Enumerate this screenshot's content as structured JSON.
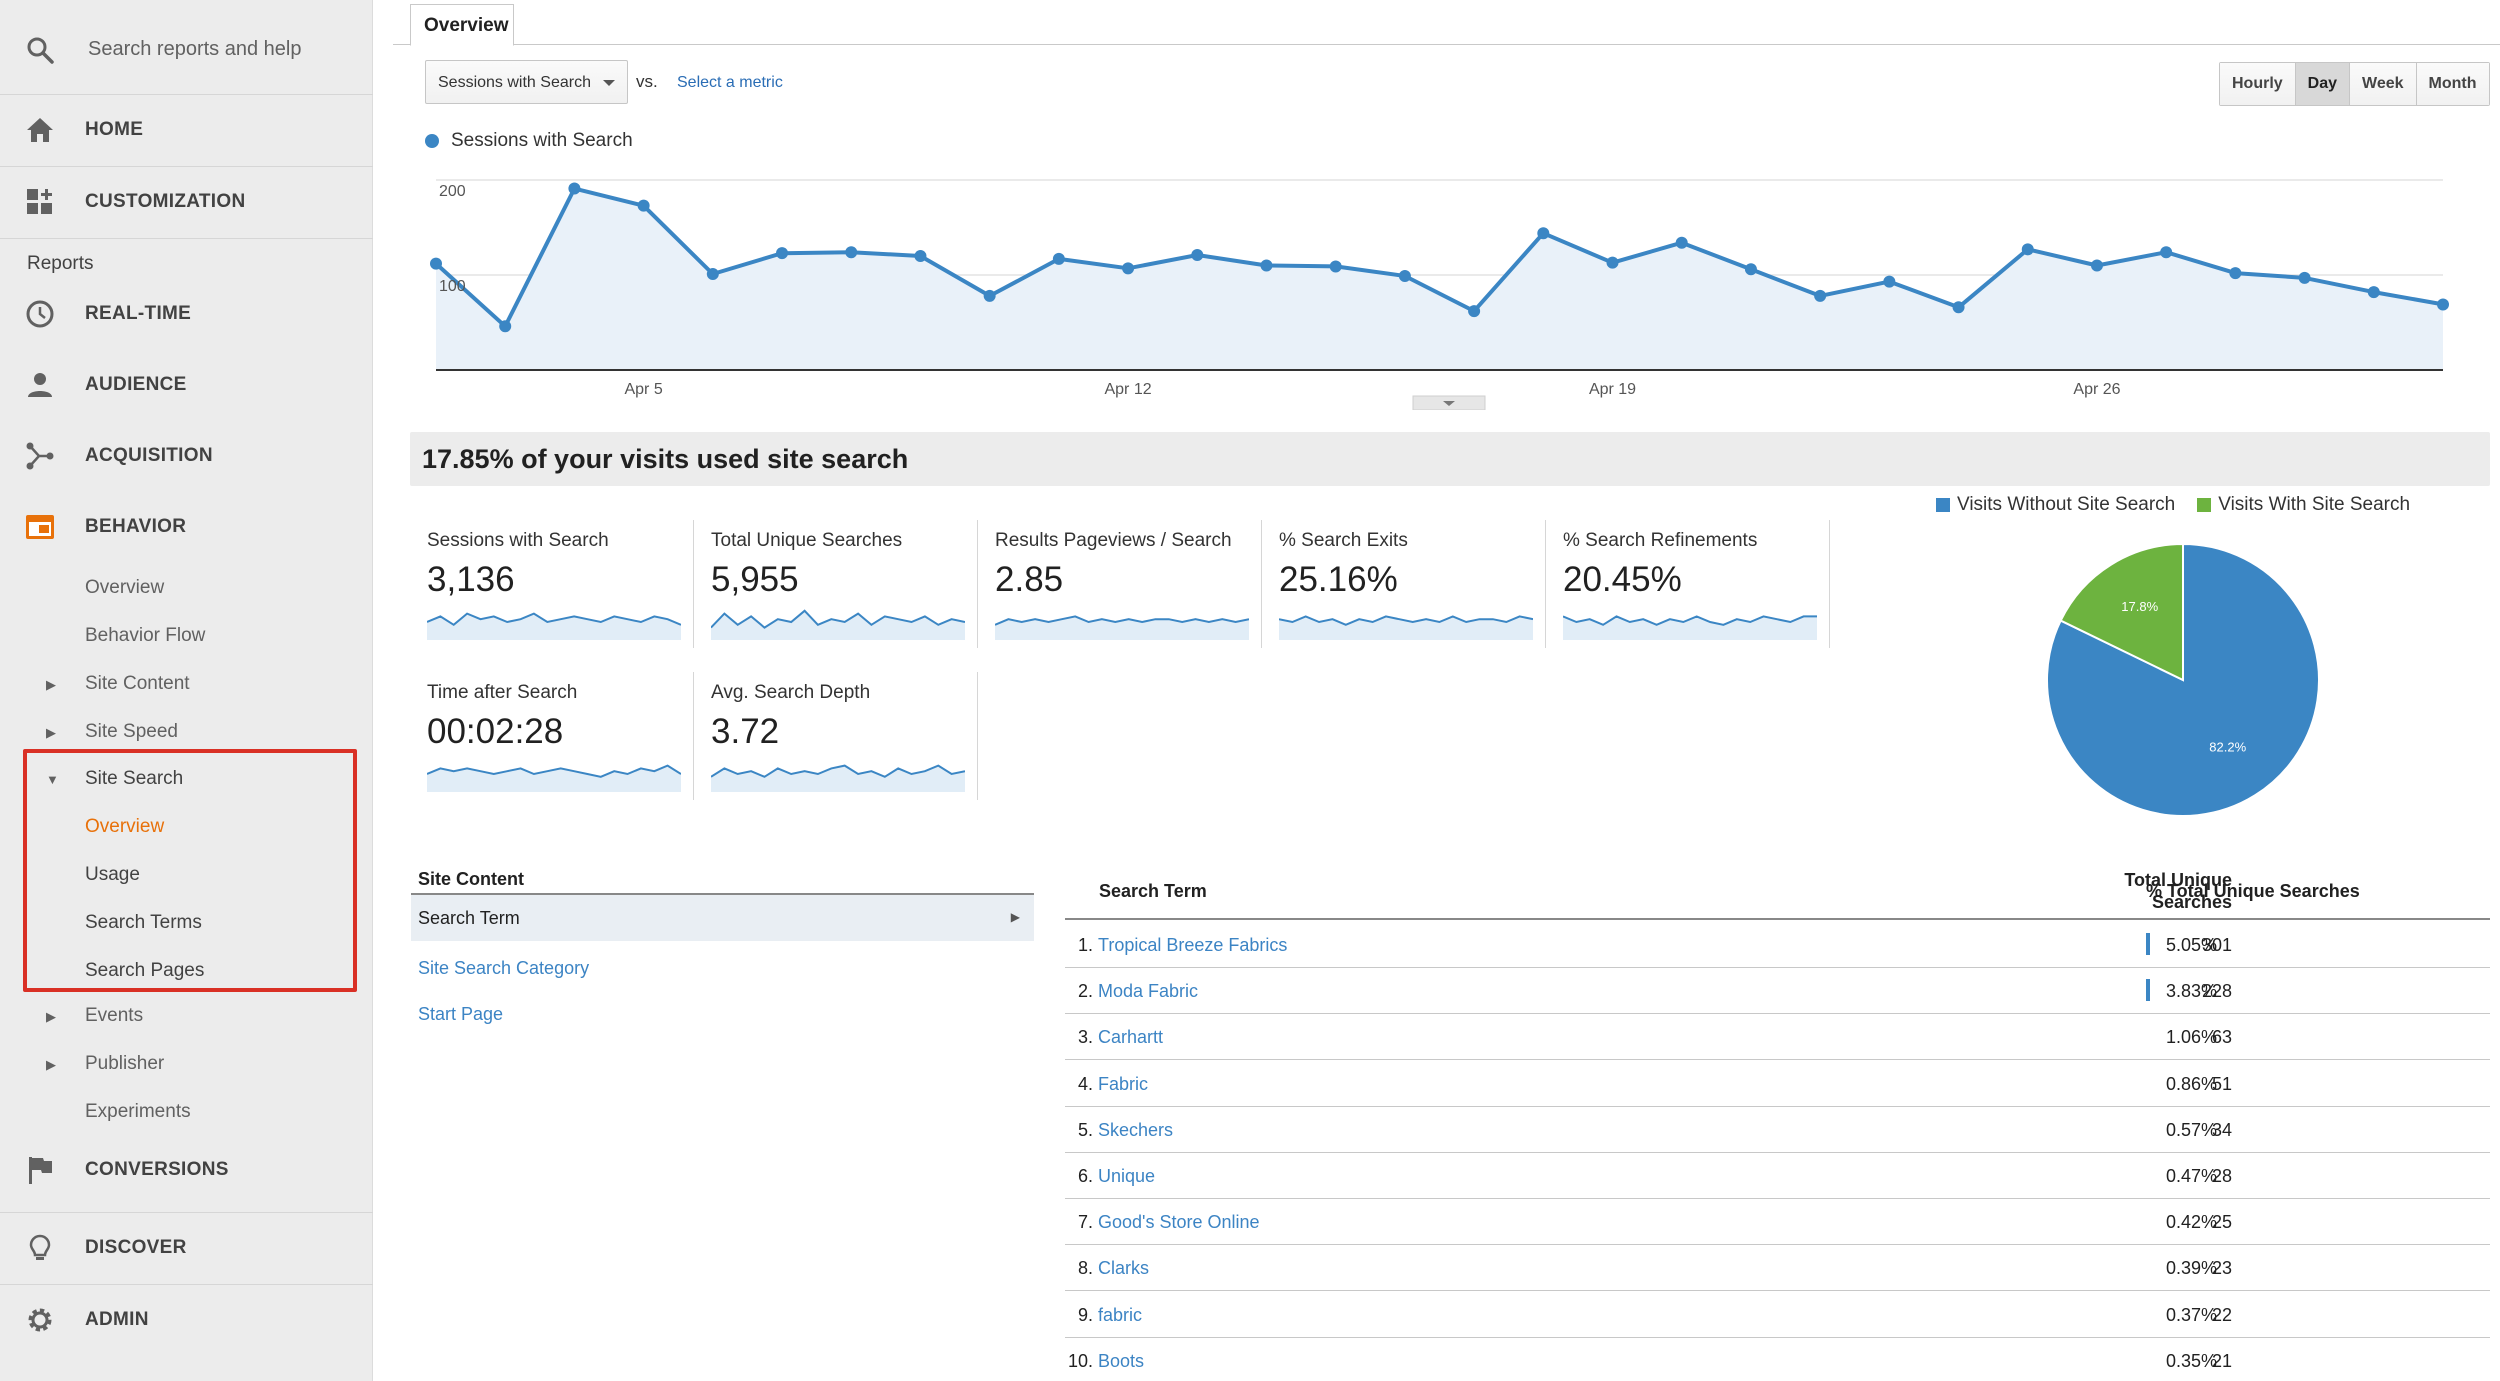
{
  "sidebar": {
    "search_placeholder": "Search reports and help",
    "home": "HOME",
    "customization": "CUSTOMIZATION",
    "reports_label": "Reports",
    "realtime": "REAL-TIME",
    "audience": "AUDIENCE",
    "acquisition": "ACQUISITION",
    "behavior": "BEHAVIOR",
    "behavior_items": {
      "overview": "Overview",
      "behavior_flow": "Behavior Flow",
      "site_content": "Site Content",
      "site_speed": "Site Speed",
      "site_search": "Site Search",
      "ss_overview": "Overview",
      "ss_usage": "Usage",
      "ss_search_terms": "Search Terms",
      "ss_search_pages": "Search Pages",
      "events": "Events",
      "publisher": "Publisher",
      "experiments": "Experiments"
    },
    "conversions": "CONVERSIONS",
    "discover": "DISCOVER",
    "admin": "ADMIN",
    "accent_color": "#e8710a",
    "highlight_color": "#d93025"
  },
  "main": {
    "tab": "Overview",
    "metric_select": "Sessions with Search",
    "vs": "vs.",
    "select_metric": "Select a metric",
    "granularity": [
      "Hourly",
      "Day",
      "Week",
      "Month"
    ],
    "granularity_active": "Day",
    "legend": "Sessions with Search",
    "series_color": "#3b86c4",
    "summary": "17.85% of your visits used site search"
  },
  "chart_data": {
    "type": "area",
    "series": [
      {
        "name": "Sessions with Search",
        "values": [
          112,
          46,
          191,
          173,
          101,
          123,
          124,
          120,
          78,
          117,
          107,
          121,
          110,
          109,
          99,
          62,
          144,
          113,
          134,
          106,
          78,
          93,
          66,
          127,
          110,
          124,
          102,
          97,
          82,
          69
        ]
      }
    ],
    "x_start": "Apr 2",
    "x_ticks": [
      "Apr 5",
      "Apr 12",
      "Apr 19",
      "Apr 26"
    ],
    "y_ticks": [
      100,
      200
    ],
    "ylim": [
      0,
      200
    ],
    "grid": true
  },
  "kpis": [
    {
      "label": "Sessions with Search",
      "value": "3,136",
      "spark": [
        5,
        7,
        4,
        8,
        6,
        7,
        5,
        6,
        8,
        5,
        6,
        7,
        6,
        5,
        7,
        6,
        5,
        7,
        6,
        4
      ]
    },
    {
      "label": "Total Unique Searches",
      "value": "5,955",
      "spark": [
        3,
        8,
        4,
        7,
        3,
        6,
        5,
        9,
        4,
        6,
        5,
        8,
        4,
        7,
        6,
        5,
        7,
        4,
        6,
        5
      ]
    },
    {
      "label": "Results Pageviews / Search",
      "value": "2.85",
      "spark": [
        4,
        6,
        5,
        6,
        5,
        6,
        7,
        5,
        6,
        5,
        6,
        5,
        6,
        6,
        5,
        6,
        5,
        6,
        5,
        6
      ]
    },
    {
      "label": "% Search Exits",
      "value": "25.16%",
      "spark": [
        6,
        5,
        7,
        5,
        6,
        4,
        6,
        5,
        7,
        6,
        5,
        6,
        5,
        7,
        5,
        6,
        6,
        5,
        7,
        6
      ]
    },
    {
      "label": "% Search Refinements",
      "value": "20.45%",
      "spark": [
        7,
        5,
        6,
        4,
        7,
        5,
        6,
        4,
        6,
        5,
        7,
        5,
        4,
        6,
        5,
        7,
        6,
        5,
        7,
        7
      ]
    },
    {
      "label": "Time after Search",
      "value": "00:02:28",
      "spark": [
        5,
        7,
        6,
        7,
        6,
        5,
        6,
        7,
        5,
        6,
        7,
        6,
        5,
        4,
        6,
        5,
        7,
        6,
        8,
        5
      ]
    },
    {
      "label": "Avg. Search Depth",
      "value": "3.72",
      "spark": [
        4,
        7,
        5,
        6,
        4,
        7,
        5,
        6,
        5,
        7,
        8,
        5,
        6,
        4,
        7,
        5,
        6,
        8,
        5,
        6
      ]
    }
  ],
  "pie": {
    "legend": [
      "Visits Without Site Search",
      "Visits With Site Search"
    ],
    "values": [
      82.2,
      17.8
    ],
    "labels": [
      "82.2%",
      "17.8%"
    ],
    "colors": [
      "#3b86c4",
      "#6db33f"
    ]
  },
  "site_content": {
    "header": "Site Content",
    "selected": "Search Term",
    "links": [
      "Site Search Category",
      "Start Page"
    ]
  },
  "table": {
    "col_term": "Search Term",
    "col_total": "Total Unique Searches",
    "col_pct": "% Total Unique Searches",
    "rows": [
      {
        "idx": "1.",
        "term": "Tropical Breeze Fabrics",
        "total": "301",
        "pct": "5.05%",
        "bar": true
      },
      {
        "idx": "2.",
        "term": "Moda Fabric",
        "total": "228",
        "pct": "3.83%",
        "bar": true
      },
      {
        "idx": "3.",
        "term": "Carhartt",
        "total": "63",
        "pct": "1.06%",
        "bar": false
      },
      {
        "idx": "4.",
        "term": "Fabric",
        "total": "51",
        "pct": "0.86%",
        "bar": false
      },
      {
        "idx": "5.",
        "term": "Skechers",
        "total": "34",
        "pct": "0.57%",
        "bar": false
      },
      {
        "idx": "6.",
        "term": "Unique",
        "total": "28",
        "pct": "0.47%",
        "bar": false
      },
      {
        "idx": "7.",
        "term": "Good's Store Online",
        "total": "25",
        "pct": "0.42%",
        "bar": false
      },
      {
        "idx": "8.",
        "term": "Clarks",
        "total": "23",
        "pct": "0.39%",
        "bar": false
      },
      {
        "idx": "9.",
        "term": "fabric",
        "total": "22",
        "pct": "0.37%",
        "bar": false
      },
      {
        "idx": "10.",
        "term": "Boots",
        "total": "21",
        "pct": "0.35%",
        "bar": false
      }
    ]
  }
}
